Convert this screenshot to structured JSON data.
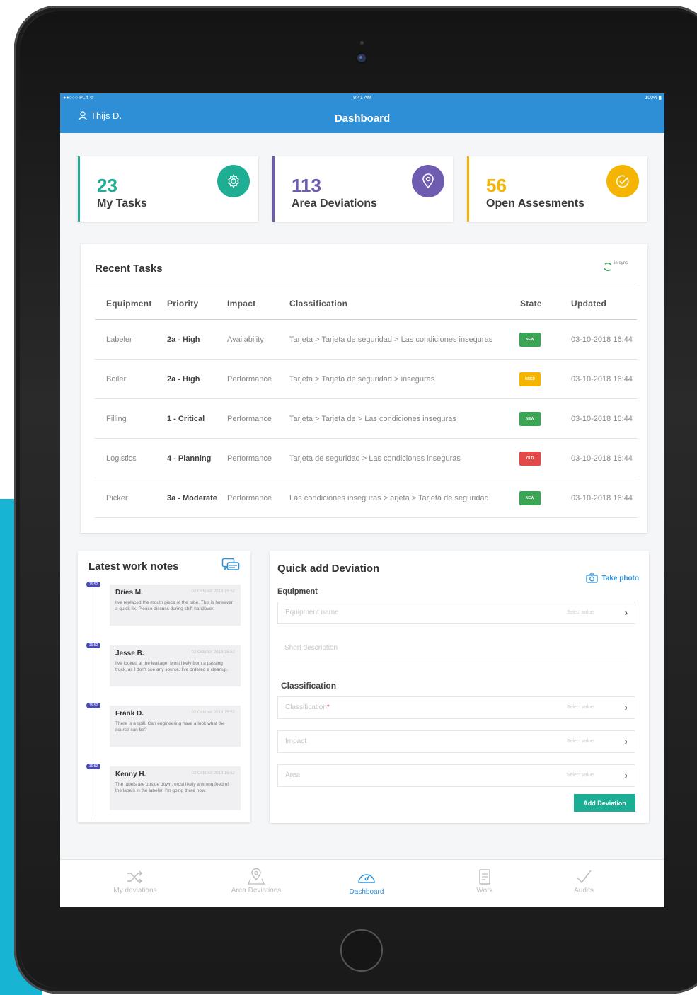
{
  "status_bar": {
    "carrier": "PL4",
    "time": "9:41 AM",
    "battery": "100%"
  },
  "header": {
    "user": "Thijs D.",
    "title": "Dashboard"
  },
  "stats": [
    {
      "value": "23",
      "label": "My Tasks",
      "color": "#1dae94",
      "icon": "gear-icon"
    },
    {
      "value": "113",
      "label": "Area Deviations",
      "color": "#6f5bb0",
      "icon": "location-pin-icon"
    },
    {
      "value": "56",
      "label": "Open Assesments",
      "color": "#f4b400",
      "icon": "check-circle-icon"
    }
  ],
  "recent_tasks": {
    "title": "Recent Tasks",
    "sync_label": "in-sync",
    "columns": [
      "Equipment",
      "Priority",
      "Impact",
      "Classification",
      "State",
      "Updated"
    ],
    "rows": [
      {
        "equipment": "Labeler",
        "priority": "2a - High",
        "impact": "Availability",
        "classification": "Tarjeta > Tarjeta de seguridad > Las condiciones inseguras",
        "state": "NEW",
        "state_color": "#3aa655",
        "updated": "03-10-2018 16:44"
      },
      {
        "equipment": "Boiler",
        "priority": "2a - High",
        "impact": "Performance",
        "classification": "Tarjeta > Tarjeta de seguridad > inseguras",
        "state": "USED",
        "state_color": "#f4b400",
        "updated": "03-10-2018 16:44"
      },
      {
        "equipment": "Filling",
        "priority": "1 - Critical",
        "impact": "Performance",
        "classification": "Tarjeta > Tarjeta de > Las condiciones inseguras",
        "state": "NEW",
        "state_color": "#3aa655",
        "updated": "03-10-2018 16:44"
      },
      {
        "equipment": "Logistics",
        "priority": "4 - Planning",
        "impact": "Performance",
        "classification": "Tarjeta de seguridad > Las condiciones inseguras",
        "state": "OLD",
        "state_color": "#e24a4a",
        "updated": "03-10-2018 16:44"
      },
      {
        "equipment": "Picker",
        "priority": "3a - Moderate",
        "impact": "Performance",
        "classification": "Las condiciones inseguras > arjeta > Tarjeta de seguridad",
        "state": "NEW",
        "state_color": "#3aa655",
        "updated": "03-10-2018 16:44"
      }
    ]
  },
  "work_notes": {
    "title": "Latest work notes",
    "items": [
      {
        "time": "15:52",
        "name": "Dries M.",
        "date": "02 October 2018 15:52",
        "text": "I've replaced the mouth piece of the tube. This is however a quick fix. Please discuss during shift handover."
      },
      {
        "time": "15:52",
        "name": "Jesse B.",
        "date": "02 October 2018 15:52",
        "text": "I've looked at the leakage. Most likely from a passing truck, as I don't see any source. I've ordered a cleanup."
      },
      {
        "time": "15:52",
        "name": "Frank D.",
        "date": "02 October 2018 15:52",
        "text": "There is a spill. Can engineering have a look what the source can be?"
      },
      {
        "time": "15:52",
        "name": "Kenny H.",
        "date": "02 October 2018 15:52",
        "text": "The labels are upside down, most likely a wrong feed of the labels in the labeler. I'm going there now."
      }
    ]
  },
  "quick_add": {
    "title": "Quick add Deviation",
    "take_photo": "Take photo",
    "equipment_label": "Equipment",
    "equipment_placeholder": "Equipment name",
    "select_value": "Select value",
    "short_description": "Short description",
    "classification_label": "Classification",
    "classification_placeholder": "Classification",
    "required_mark": "*",
    "impact_placeholder": "Impact",
    "area_placeholder": "Area",
    "add_button": "Add Deviation"
  },
  "tabs": [
    {
      "label": "My deviations",
      "icon": "shuffle-icon",
      "active": false
    },
    {
      "label": "Area Deviations",
      "icon": "map-pin-icon",
      "active": false
    },
    {
      "label": "Dashboard",
      "icon": "speedometer-icon",
      "active": true
    },
    {
      "label": "Work",
      "icon": "work-icon",
      "active": false
    },
    {
      "label": "Audits",
      "icon": "checkmark-icon",
      "active": false
    }
  ]
}
